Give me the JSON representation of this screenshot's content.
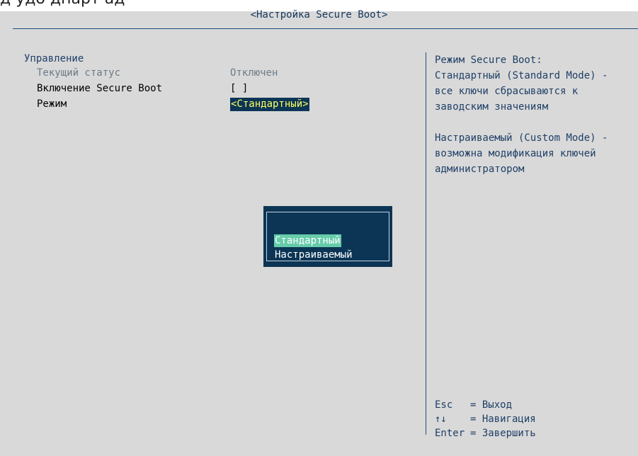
{
  "page_title": "<Настройка Secure Boot>",
  "left_panel": {
    "section": "Управление",
    "rows": [
      {
        "label": "Текущий статус",
        "value": "Отключен"
      },
      {
        "label": "Включение Secure Boot",
        "value": "[ ]"
      },
      {
        "label": "Режим",
        "value": "<Стандартный>"
      }
    ]
  },
  "help": {
    "lines_1": [
      "Режим Secure Boot:",
      "Стандартный (Standard Mode) -",
      "все ключи сбрасываются к",
      "заводским значениям"
    ],
    "lines_2": [
      "Настраиваемый (Custom Mode) -",
      "возможна модификация ключей",
      "администратором"
    ]
  },
  "keys": [
    {
      "key": "Esc",
      "action": "= Выход"
    },
    {
      "key": "↑↓",
      "action": "= Навигация"
    },
    {
      "key": "Enter",
      "action": "= Завершить"
    }
  ],
  "popup": {
    "options": [
      "Стандартный",
      "Настраиваемый"
    ],
    "selected": "Стандартный"
  },
  "colors": {
    "background": "#d9d9d9",
    "text_primary": "#1e3f66",
    "selection_bg": "#0c3555",
    "selection_text": "#ffff66",
    "popup_highlight": "#66ccaa"
  }
}
